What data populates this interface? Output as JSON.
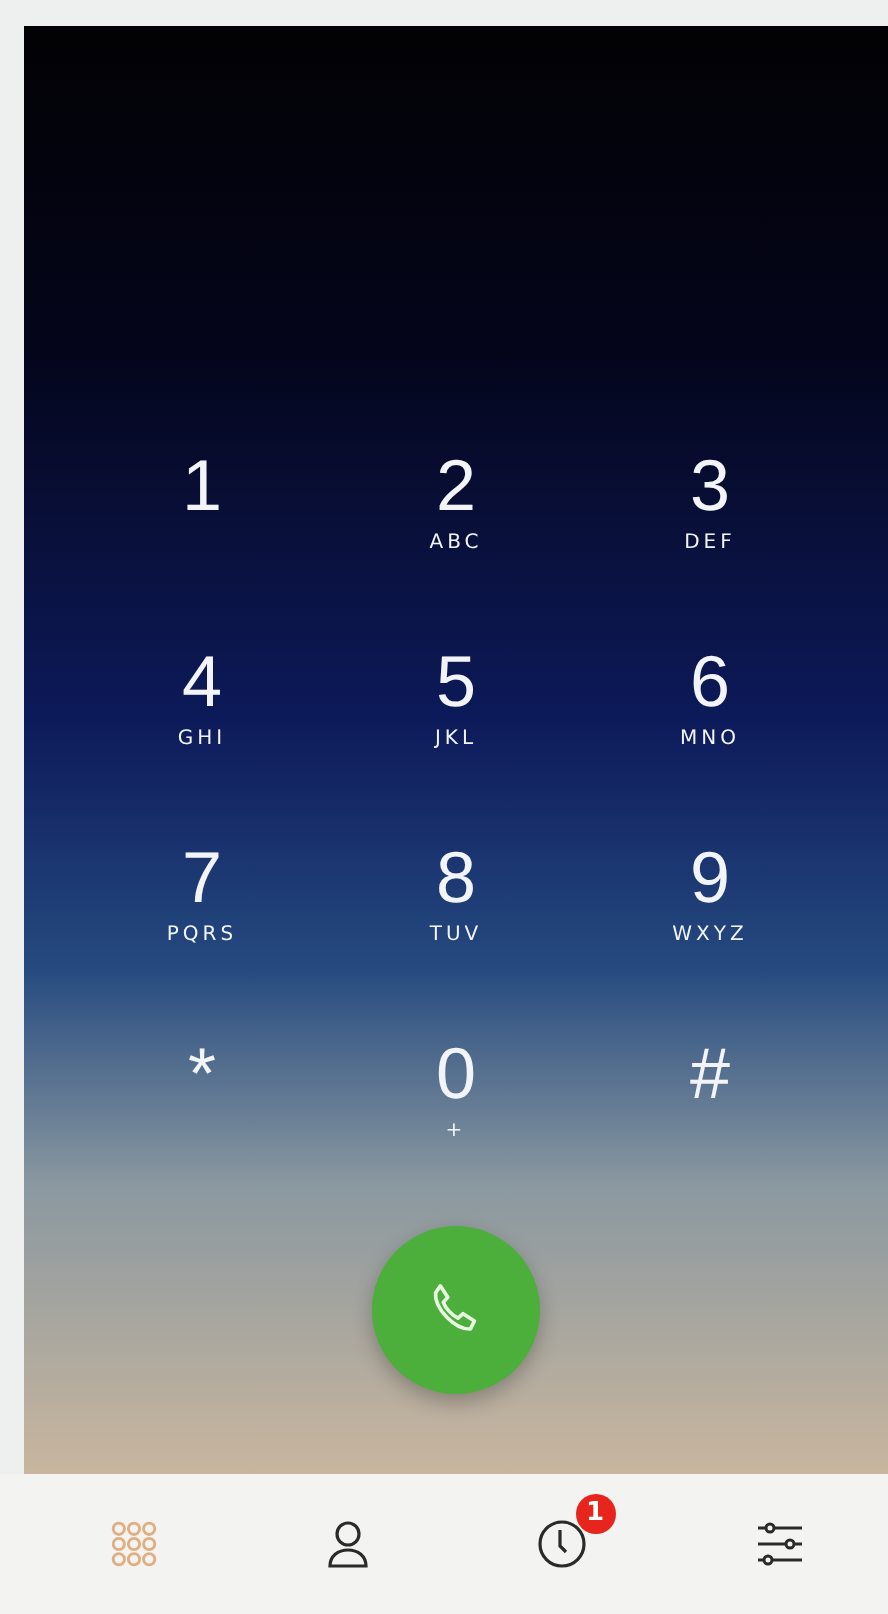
{
  "keypad": [
    {
      "digit": "1"
    },
    {
      "digit": "2",
      "letters": "ABC"
    },
    {
      "digit": "3",
      "letters": "DEF"
    },
    {
      "digit": "4",
      "letters": "GHI"
    },
    {
      "digit": "5",
      "letters": "JKL"
    },
    {
      "digit": "6",
      "letters": "MNO"
    },
    {
      "digit": "7",
      "letters": "PQRS"
    },
    {
      "digit": "8",
      "letters": "TUV"
    },
    {
      "digit": "9",
      "letters": "WXYZ"
    },
    {
      "digit": "*"
    },
    {
      "digit": "0",
      "letters": "+"
    },
    {
      "digit": "#"
    }
  ],
  "tab_bar": [
    {
      "kind": "keypad",
      "selected": true
    },
    {
      "kind": "contacts",
      "selected": false
    },
    {
      "kind": "recents",
      "selected": false,
      "badge": "1"
    },
    {
      "kind": "settings",
      "selected": false
    }
  ]
}
